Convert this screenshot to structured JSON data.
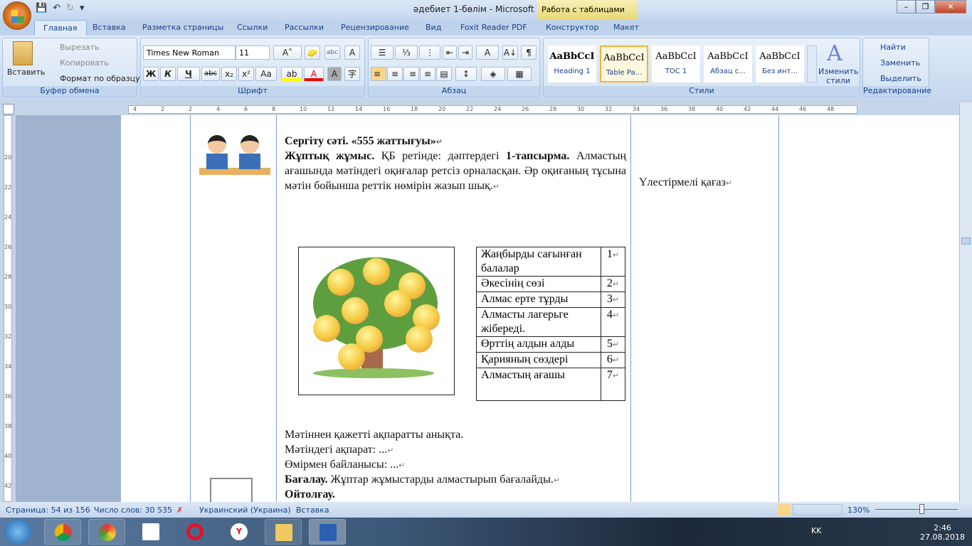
{
  "window": {
    "title": "әдебиет 1-бөлім - Microsoft Word",
    "context_title": "Работа с таблицами",
    "min": "–",
    "max": "❐",
    "close": "✕"
  },
  "qat": {
    "save": "💾",
    "undo": "↶",
    "redo": "↻",
    "more": "▾"
  },
  "tabs": [
    "Главная",
    "Вставка",
    "Разметка страницы",
    "Ссылки",
    "Рассылки",
    "Рецензирование",
    "Вид",
    "Foxit Reader PDF",
    "Конструктор",
    "Макет"
  ],
  "clipboard": {
    "paste": "Вставить",
    "cut": "Вырезать",
    "copy": "Копировать",
    "format_painter": "Формат по образцу",
    "label": "Буфер обмена"
  },
  "font": {
    "name": "Times New Roman",
    "size": "11",
    "label": "Шрифт",
    "grow": "A˄",
    "shrink": "A˅",
    "clear": "🧽",
    "abc": "abc",
    "border": "A",
    "bold": "Ж",
    "italic": "К",
    "underline": "Ч",
    "strike": "abc",
    "sub": "x₂",
    "sup": "x²",
    "case": "Aa",
    "highlight": "ab",
    "color": "A",
    "shade": "A",
    "enclose": "字"
  },
  "paragraph": {
    "label": "Абзац",
    "bullets": "☰",
    "numbering": "⅓",
    "multilevel": "⋮",
    "dec_indent": "⇤",
    "inc_indent": "⇥",
    "sort": "A↓",
    "show": "¶",
    "align_left": "≡",
    "center": "≡",
    "right": "≡",
    "justify": "≡",
    "distributed": "▤",
    "spacing": "↕",
    "shading": "◈",
    "borders": "▦",
    "cjk": "A"
  },
  "styles": {
    "label": "Стили",
    "items": [
      {
        "sample": "AaBbCcI",
        "name": "Heading 1"
      },
      {
        "sample": "AaBbCcI",
        "name": "Table Pa..."
      },
      {
        "sample": "AaBbCcI",
        "name": "TOC 1"
      },
      {
        "sample": "AaBbCcI",
        "name": "Абзац с..."
      },
      {
        "sample": "AaBbCcI",
        "name": "Без инт..."
      }
    ],
    "change": "Изменить стили"
  },
  "editing": {
    "label": "Редактирование",
    "find": "Найти",
    "replace": "Заменить",
    "select": "Выделить"
  },
  "ruler": {
    "ticks": [
      "4",
      "2",
      "2",
      "4",
      "6",
      "8",
      "10",
      "12",
      "14",
      "16",
      "18",
      "20",
      "22",
      "24",
      "26",
      "28",
      "30",
      "32",
      "34",
      "36",
      "38",
      "40",
      "42",
      "44",
      "46",
      "48"
    ],
    "vticks": [
      "20",
      "22",
      "24",
      "26",
      "28",
      "30",
      "32",
      "34",
      "36",
      "38",
      "40",
      "42"
    ]
  },
  "document": {
    "title_line": "Сергіту сәті. «555 жаттығуы»",
    "pair_bold": "Жұптық жұмыс.",
    "pair_text": " ҚБ ретінде: дәптердегі ",
    "task_bold": "1-тапсырма.",
    "body": "Алмастың ағашында мәтіндегі оқиғалар ретсіз орналасқан. Әр оқиғаның тұсына мәтін бойынша реттік нөмірін жазып шық.",
    "handout": "Үлестірмелі қағаз",
    "table": [
      [
        "Жаңбырды сағынған балалар",
        "1"
      ],
      [
        "Әкесінің сөзі",
        "2"
      ],
      [
        "Алмас ерте тұрды",
        "3"
      ],
      [
        "Алмасты лагерьге жібереді.",
        "4"
      ],
      [
        "Өрттің алдын алды",
        "5"
      ],
      [
        "Қарияның сөздері",
        "6"
      ],
      [
        "Алмастың ағашы",
        "7"
      ]
    ],
    "line1": "Мәтіннен қажетті ақпаратты анықта.",
    "line2": "Мәтіндегі ақпарат: ...",
    "line3": "Өмірмен байланысы: ...",
    "assess_bold": "Бағалау.",
    "assess_text": " Жұптар жұмыстарды алмастырып бағалайды.",
    "reflection": "Ойтолғау.",
    "mark": "↵"
  },
  "status": {
    "page": "Страница: 54 из 156",
    "words": "Число слов: 30 535",
    "lang": "Украинский (Украина)",
    "mode": "Вставка",
    "zoom": "130%"
  },
  "tray": {
    "lang": "KK",
    "time": "2:46",
    "date": "27.08.2018"
  }
}
